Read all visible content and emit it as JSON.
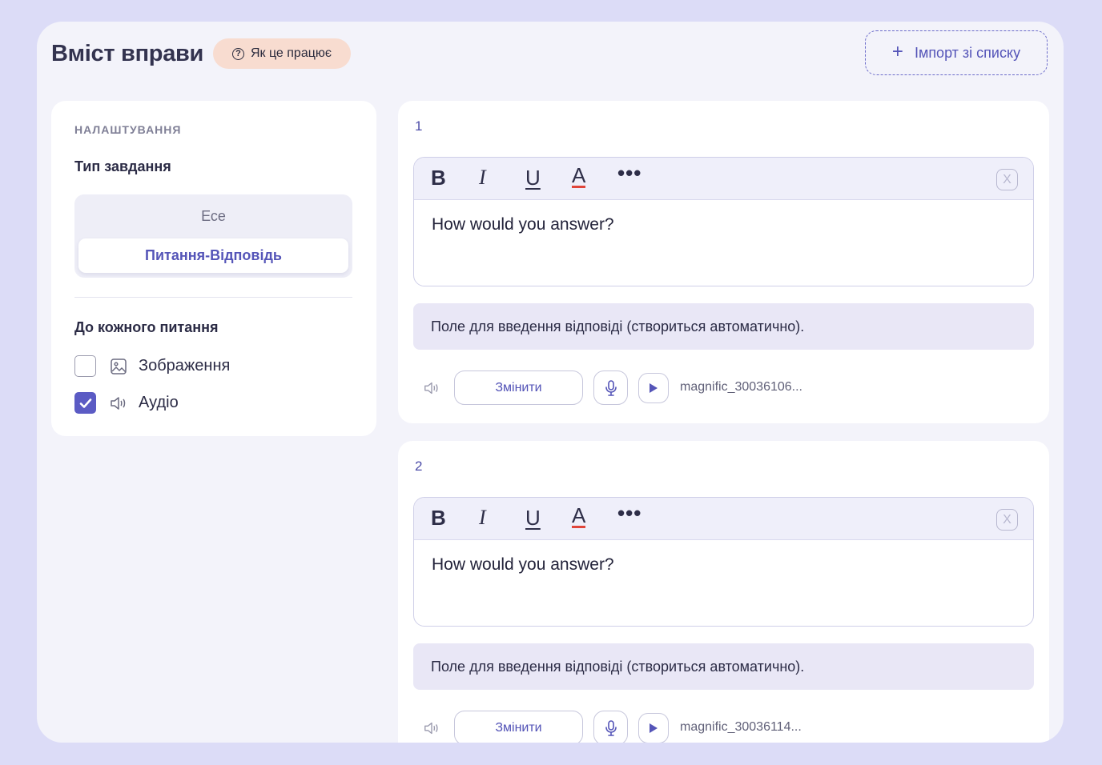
{
  "header": {
    "title": "Вміст вправи",
    "how_it_works": "Як це працює",
    "import_label": "Імпорт зі списку"
  },
  "settings": {
    "heading": "НАЛАШТУВАННЯ",
    "task_type_label": "Тип завдання",
    "task_types": [
      "Есе",
      "Питання-Відповідь"
    ],
    "selected_task_type": "Питання-Відповідь",
    "per_question_label": "До кожного питання",
    "options": [
      {
        "label": "Зображення",
        "icon": "image-icon",
        "checked": false
      },
      {
        "label": "Аудіо",
        "icon": "speaker-icon",
        "checked": true
      }
    ]
  },
  "questions": [
    {
      "number": "1",
      "text": "How would you answer?",
      "answer_placeholder": "Поле для введення відповіді (створиться автоматично).",
      "change_label": "Змінити",
      "audio_file": "magnific_30036106..."
    },
    {
      "number": "2",
      "text": "How would you answer?",
      "answer_placeholder": "Поле для введення відповіді (створиться автоматично).",
      "change_label": "Змінити",
      "audio_file": "magnific_30036114..."
    }
  ],
  "toolbar": {
    "bold": "B",
    "italic": "I",
    "underline": "U",
    "color": "A",
    "more": "•••",
    "close": "X"
  },
  "colors": {
    "background": "#dcdcf7",
    "accent": "#5b5bc4",
    "how_badge": "#f8dcd0",
    "answer_field": "#e9e7f6"
  }
}
